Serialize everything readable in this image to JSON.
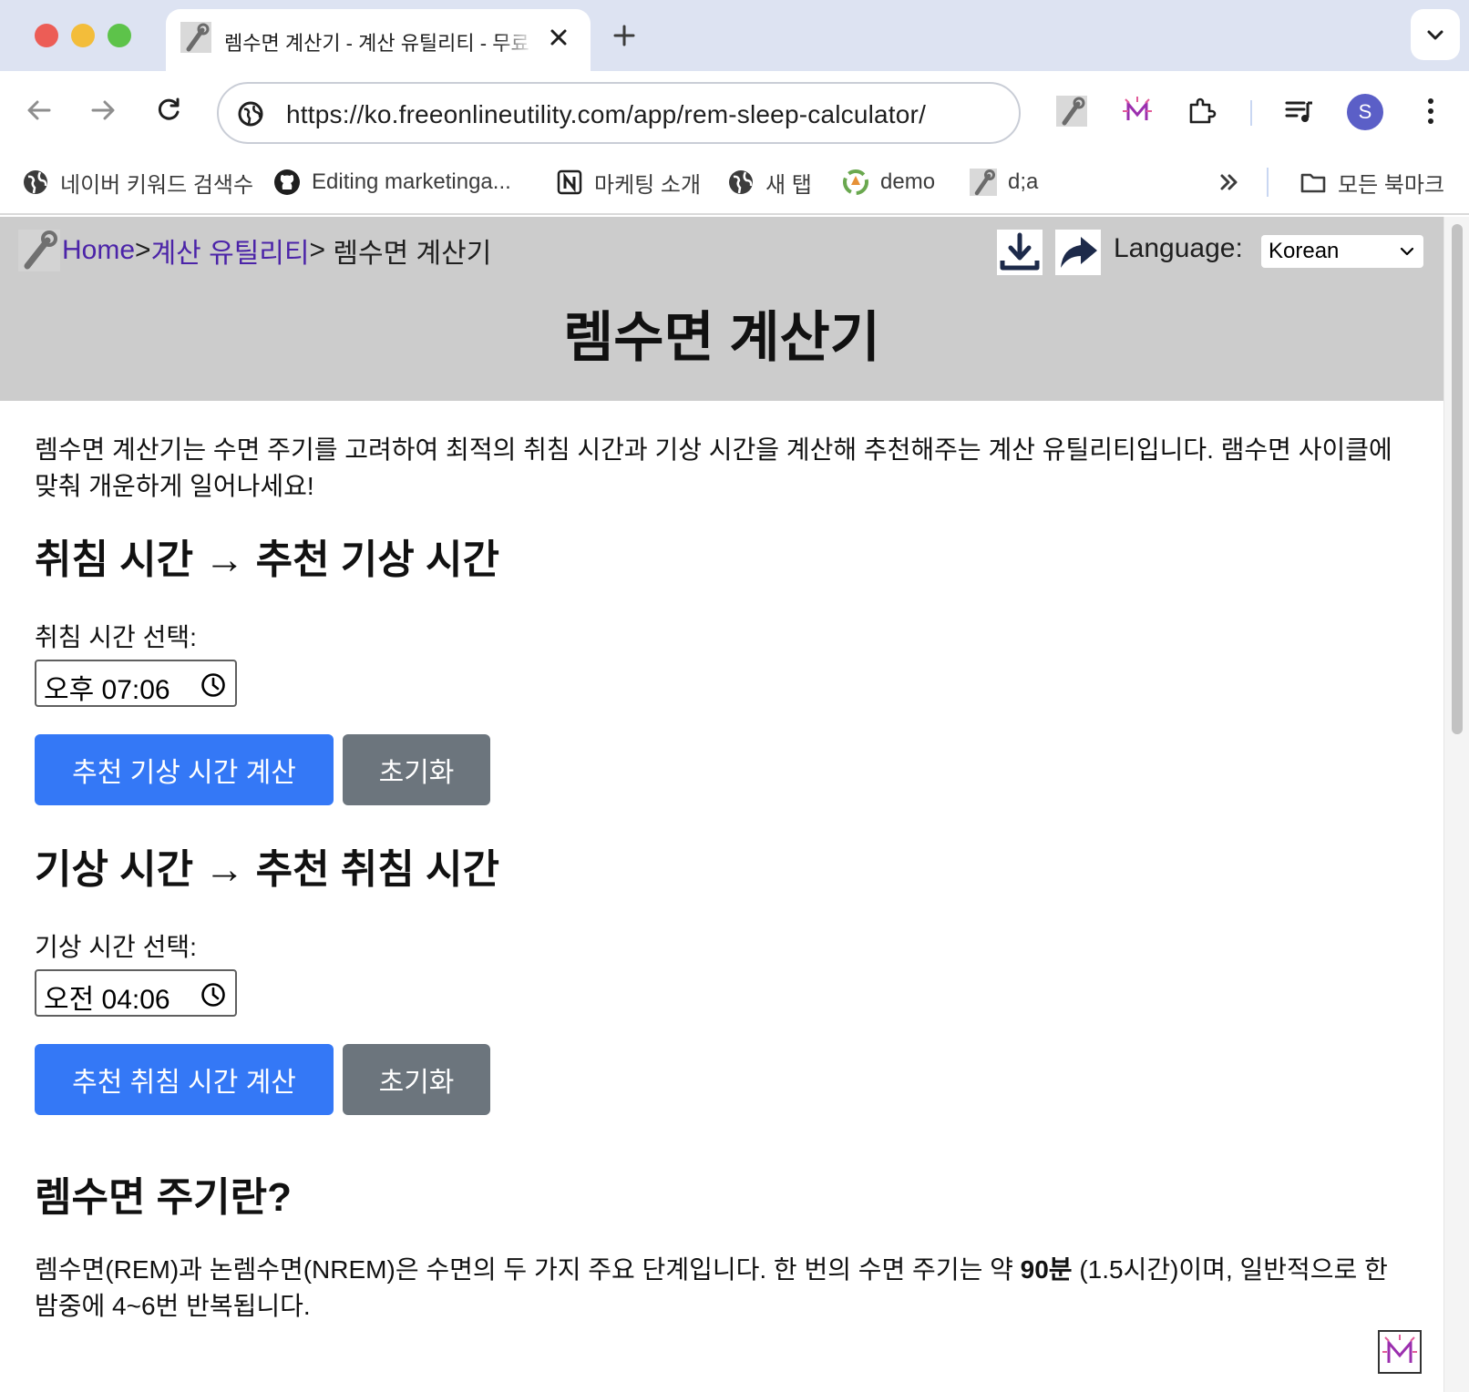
{
  "browser": {
    "tab_title": "렘수면 계산기 - 계산 유틸리티 - 무료 온라인 유틸리티",
    "url": "https://ko.freeonlineutility.com/app/rem-sleep-calculator/",
    "profile_initial": "S",
    "bookmarks": [
      {
        "label": "네이버 키워드 검색수",
        "icon": "globe-icon"
      },
      {
        "label": "Editing marketinga...",
        "icon": "github-icon"
      },
      {
        "label": "마케팅 소개",
        "icon": "notion-icon"
      },
      {
        "label": "새 탭",
        "icon": "globe-icon"
      },
      {
        "label": "demo",
        "icon": "recycle-icon"
      },
      {
        "label": "d;a",
        "icon": "wrench-icon"
      }
    ],
    "all_bookmarks": "모든 북마크"
  },
  "header": {
    "breadcrumb": {
      "home": "Home",
      "sep1": ">",
      "category": "계산 유틸리티",
      "sep2": ">",
      "current": " 렘수면 계산기"
    },
    "language_label": "Language:",
    "language_value": "Korean",
    "title": "렘수면 계산기"
  },
  "content": {
    "intro": "렘수면 계산기는 수면 주기를 고려하여 최적의 취침 시간과 기상 시간을 계산해 추천해주는 계산 유틸리티입니다. 램수면 사이클에 맞춰 개운하게 일어나세요!",
    "section1": {
      "heading": "취침 시간 → 추천 기상 시간",
      "label": "취침 시간 선택:",
      "time_value": "오후 07:06",
      "calc_button": "추천 기상 시간 계산",
      "reset_button": "초기화"
    },
    "section2": {
      "heading": "기상 시간 → 추천 취침 시간",
      "label": "기상 시간 선택:",
      "time_value": "오전 04:06",
      "calc_button": "추천 취침 시간 계산",
      "reset_button": "초기화"
    },
    "section3": {
      "heading": "렘수면 주기란?",
      "para_before": "렘수면(REM)과 논렘수면(NREM)은 수면의 두 가지 주요 단계입니다. 한 번의 수면 주기는 약 ",
      "para_bold": "90분",
      "para_after": " (1.5시간)이며, 일반적으로 한밤중에 4~6번 반복됩니다."
    }
  }
}
